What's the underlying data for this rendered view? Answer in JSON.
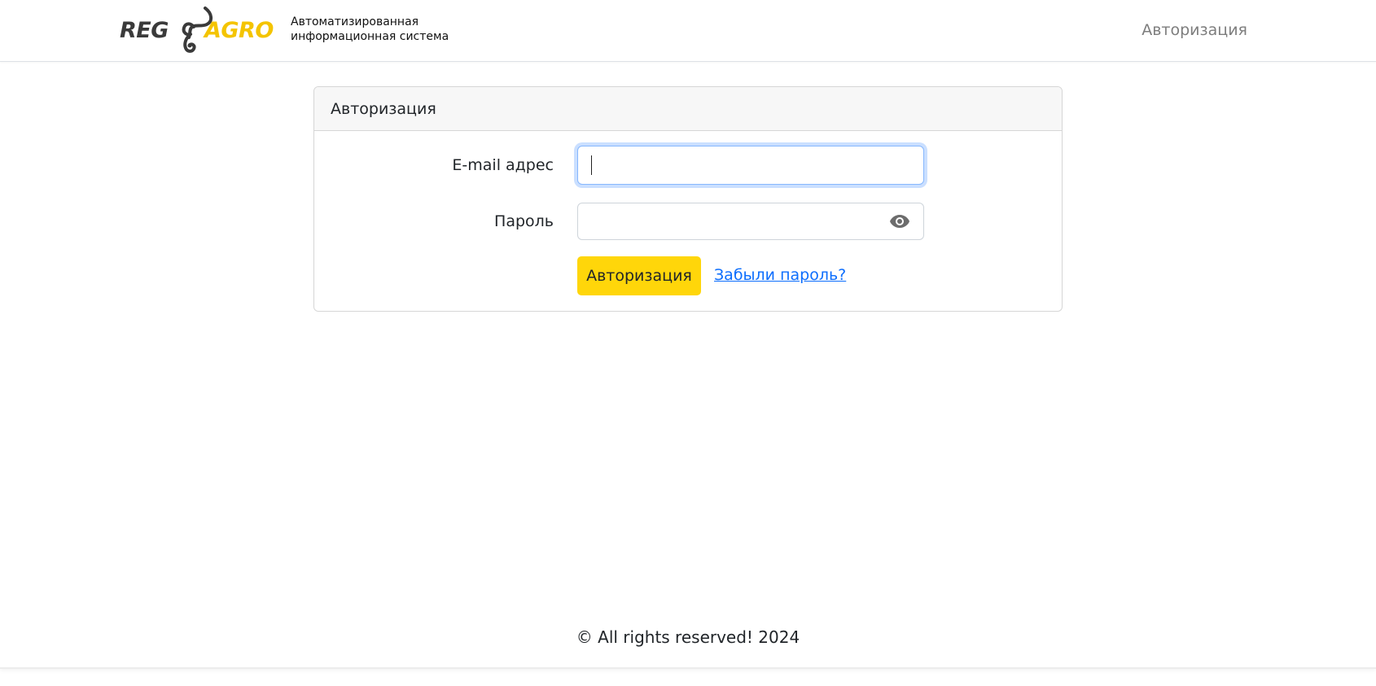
{
  "header": {
    "logo": {
      "text_left": "REG",
      "text_right": "AGRO",
      "left_color": "#3a3a3a",
      "right_color": "#f4c400",
      "icon": "bull-head-icon"
    },
    "subtitle_line1": "Автоматизированная",
    "subtitle_line2": "информационная система",
    "nav_link": "Авторизация"
  },
  "login": {
    "title": "Авторизация",
    "email_label": "E-mail адрес",
    "email_value": "",
    "password_label": "Пароль",
    "password_value": "",
    "password_toggle_icon": "eye-icon",
    "submit_label": "Авторизация",
    "forgot_link": "Забыли пароль?"
  },
  "footer": {
    "text": "© All rights reserved! 2024"
  },
  "colors": {
    "accent": "#ffd60a",
    "link": "#0d6efd",
    "focus_border": "#86b7fe"
  }
}
